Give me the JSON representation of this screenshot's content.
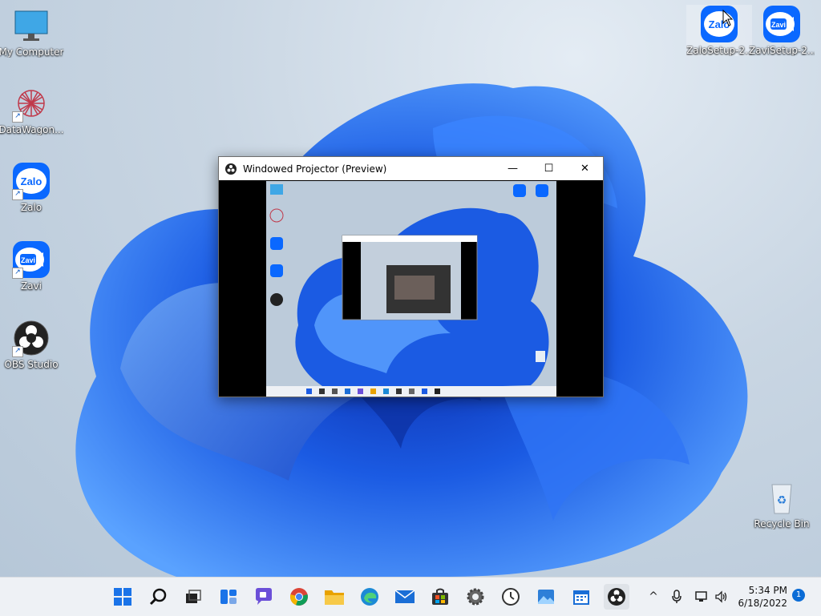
{
  "desktop": {
    "icons": [
      {
        "label": "My Computer",
        "icon": "monitor-icon"
      },
      {
        "label": "DataWagon...",
        "icon": "datawagon-icon"
      },
      {
        "label": "Zalo",
        "icon": "zalo-icon",
        "text": "Zalo"
      },
      {
        "label": "Zavi",
        "icon": "zavi-icon",
        "text": "Zavi"
      },
      {
        "label": "OBS Studio",
        "icon": "obs-icon"
      },
      {
        "label": "ZaloSetup-2...",
        "icon": "zalo-icon",
        "text": "Zalo"
      },
      {
        "label": "ZaviSetup-2...",
        "icon": "zavi-icon",
        "text": "Zavi"
      },
      {
        "label": "Recycle Bin",
        "icon": "recycle-bin-icon"
      }
    ]
  },
  "projector": {
    "title": "Windowed Projector (Preview)",
    "minimize": "—",
    "maximize": "☐",
    "close": "✕"
  },
  "taskbar": {
    "apps": [
      "start-icon",
      "search-icon",
      "task-view-icon",
      "widgets-icon",
      "chat-icon",
      "chrome-icon",
      "file-explorer-icon",
      "edge-icon",
      "mail-icon",
      "store-icon",
      "settings-icon",
      "clock-icon",
      "photos-icon",
      "calendar-icon",
      "obs-icon"
    ],
    "tray": {
      "chevron": "^"
    },
    "time": "5:34 PM",
    "date": "6/18/2022",
    "notifications": "1"
  },
  "colors": {
    "accent": "#0b6cd6",
    "bloom": "#1d5fe0",
    "zalo": "#0a68ff"
  }
}
